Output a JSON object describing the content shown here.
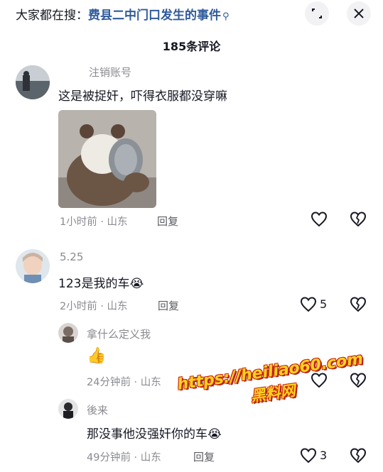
{
  "header": {
    "search_prefix": "大家都在搜：",
    "search_query": "费县二中门口发生的事件",
    "search_icon": "search-icon",
    "expand_icon": "expand-icon",
    "close_icon": "close-icon"
  },
  "comment_count": "185条评论",
  "comments": [
    {
      "username": "注销账号",
      "text": "这是被捉奸，吓得衣服都没穿嘛",
      "has_image": true,
      "image_icon": "panda-with-bowl-sticker",
      "time_location": "1小时前 · 山东",
      "reply_label": "回复",
      "like_count": ""
    },
    {
      "username": "5.25",
      "text": "123是我的车",
      "emoji": "😭",
      "time_location": "2小时前 · 山东",
      "reply_label": "回复",
      "like_count": "5"
    }
  ],
  "replies": [
    {
      "username": "拿什么定义我",
      "emoji": "👍",
      "time_location": "24分钟前 · 山东",
      "reply_label": "回复",
      "like_count": ""
    },
    {
      "username": "後来",
      "text": "那没事他没强奸你的车",
      "emoji": "😭",
      "time_location": "49分钟前 · 山东",
      "reply_label": "回复",
      "like_count": "3"
    }
  ],
  "watermark": {
    "url": "https://heiliao60.com",
    "name": "黑料网"
  },
  "colors": {
    "link": "#2f5a9c",
    "muted": "#8a8b91",
    "text": "#161823"
  }
}
